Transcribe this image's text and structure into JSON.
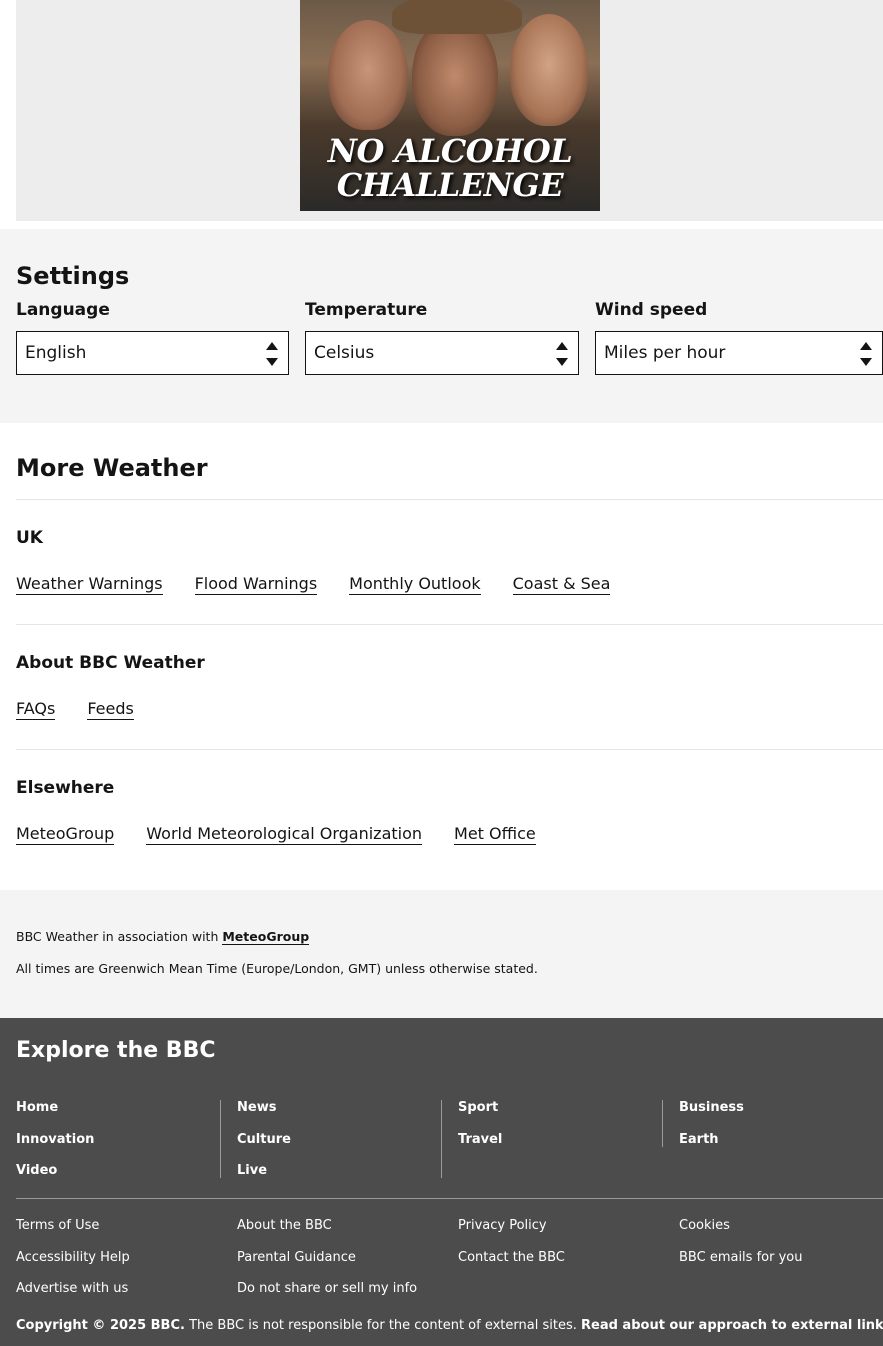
{
  "ad": {
    "headline_line1": "NO ALCOHOL",
    "headline_line2": "CHALLENGE"
  },
  "settings": {
    "title": "Settings",
    "language": {
      "label": "Language",
      "value": "English"
    },
    "temperature": {
      "label": "Temperature",
      "value": "Celsius"
    },
    "wind": {
      "label": "Wind speed",
      "value": "Miles per hour"
    }
  },
  "more_weather": {
    "title": "More Weather",
    "uk": {
      "title": "UK",
      "links": [
        "Weather Warnings",
        "Flood Warnings",
        "Monthly Outlook",
        "Coast & Sea"
      ]
    },
    "about": {
      "title": "About BBC Weather",
      "links": [
        "FAQs",
        "Feeds"
      ]
    },
    "elsewhere": {
      "title": "Elsewhere",
      "links": [
        "MeteoGroup",
        "World Meteorological Organization",
        "Met Office"
      ]
    }
  },
  "association": {
    "prefix": "BBC Weather in association with ",
    "partner": "MeteoGroup",
    "times_note": "All times are Greenwich Mean Time (Europe/London, GMT) unless otherwise stated."
  },
  "footer": {
    "title": "Explore the BBC",
    "nav": [
      [
        "Home",
        "Innovation",
        "Video"
      ],
      [
        "News",
        "Culture",
        "Live"
      ],
      [
        "Sport",
        "Travel"
      ],
      [
        "Business",
        "Earth"
      ]
    ],
    "legal": [
      [
        "Terms of Use",
        "Accessibility Help",
        "Advertise with us"
      ],
      [
        "About the BBC",
        "Parental Guidance",
        "Do not share or sell my info"
      ],
      [
        "Privacy Policy",
        "Contact the BBC"
      ],
      [
        "Cookies",
        "BBC emails for you"
      ]
    ],
    "copyright": "Copyright © 2025 BBC.",
    "disclaimer": " The BBC is not responsible for the content of external sites. ",
    "external_link": "Read about our approach to external linking."
  }
}
